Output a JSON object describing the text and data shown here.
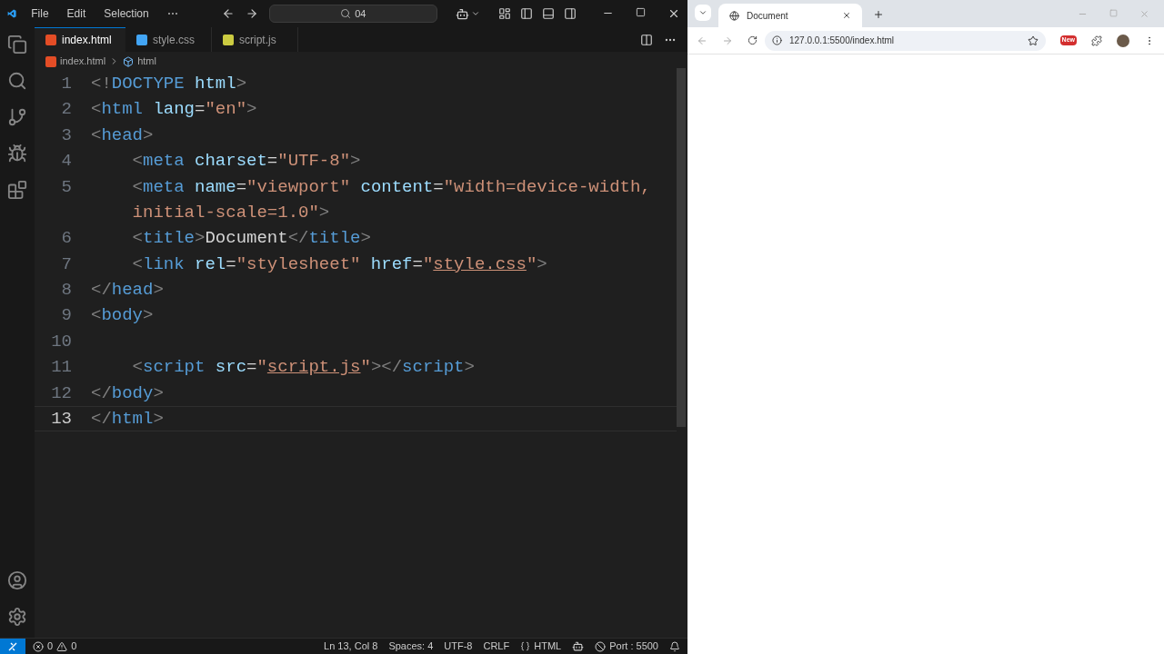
{
  "editor": {
    "menu": [
      "File",
      "Edit",
      "Selection",
      "⋯"
    ],
    "search": "04",
    "tabs": [
      {
        "label": "index.html",
        "kind": "html",
        "selected": true
      },
      {
        "label": "style.css",
        "kind": "css",
        "selected": false
      },
      {
        "label": "script.js",
        "kind": "js",
        "selected": false
      }
    ],
    "breadcrumb": [
      {
        "label": "index.html",
        "kind": "html"
      },
      {
        "label": "html",
        "kind": "element"
      }
    ],
    "lines": [
      {
        "number": "1",
        "current": false,
        "tokens": [
          {
            "kind": "punct",
            "text": "<!"
          },
          {
            "kind": "tag",
            "text": "DOCTYPE"
          },
          {
            "kind": "attr",
            "text": " html"
          },
          {
            "kind": "punct",
            "text": ">"
          }
        ]
      },
      {
        "number": "2",
        "current": false,
        "tokens": [
          {
            "kind": "punct",
            "text": "<"
          },
          {
            "kind": "tag",
            "text": "html"
          },
          {
            "kind": "attr",
            "text": " lang"
          },
          {
            "kind": "plain",
            "text": "="
          },
          {
            "kind": "string",
            "text": "\"en\""
          },
          {
            "kind": "punct",
            "text": ">"
          }
        ]
      },
      {
        "number": "3",
        "current": false,
        "tokens": [
          {
            "kind": "punct",
            "text": "<"
          },
          {
            "kind": "tag",
            "text": "head"
          },
          {
            "kind": "punct",
            "text": ">"
          }
        ]
      },
      {
        "number": "4",
        "current": false,
        "tokens": [
          {
            "kind": "punct",
            "text": "    <"
          },
          {
            "kind": "tag",
            "text": "meta"
          },
          {
            "kind": "attr",
            "text": " charset"
          },
          {
            "kind": "plain",
            "text": "="
          },
          {
            "kind": "string",
            "text": "\"UTF-8\""
          },
          {
            "kind": "punct",
            "text": ">"
          }
        ]
      },
      {
        "number": "5",
        "current": false,
        "tokens": [
          {
            "kind": "punct",
            "text": "    <"
          },
          {
            "kind": "tag",
            "text": "meta"
          },
          {
            "kind": "attr",
            "text": " name"
          },
          {
            "kind": "plain",
            "text": "="
          },
          {
            "kind": "string",
            "text": "\"viewport\""
          },
          {
            "kind": "attr",
            "text": " content"
          },
          {
            "kind": "plain",
            "text": "="
          },
          {
            "kind": "string",
            "text": "\"width=device-width,"
          }
        ]
      },
      {
        "current": false,
        "tokens": [
          {
            "kind": "string",
            "text": "    initial-scale=1.0\""
          },
          {
            "kind": "punct",
            "text": ">"
          }
        ]
      },
      {
        "number": "6",
        "current": false,
        "tokens": [
          {
            "kind": "punct",
            "text": "    <"
          },
          {
            "kind": "tag",
            "text": "title"
          },
          {
            "kind": "punct",
            "text": ">"
          },
          {
            "kind": "plain",
            "text": "Document"
          },
          {
            "kind": "punct",
            "text": "</"
          },
          {
            "kind": "tag",
            "text": "title"
          },
          {
            "kind": "punct",
            "text": ">"
          }
        ]
      },
      {
        "number": "7",
        "current": false,
        "tokens": [
          {
            "kind": "punct",
            "text": "    <"
          },
          {
            "kind": "tag",
            "text": "link"
          },
          {
            "kind": "attr",
            "text": " rel"
          },
          {
            "kind": "plain",
            "text": "="
          },
          {
            "kind": "string",
            "text": "\"stylesheet\""
          },
          {
            "kind": "attr",
            "text": " href"
          },
          {
            "kind": "plain",
            "text": "="
          },
          {
            "kind": "string",
            "text": "\""
          },
          {
            "kind": "link",
            "text": "style.css"
          },
          {
            "kind": "string",
            "text": "\""
          },
          {
            "kind": "punct",
            "text": ">"
          }
        ]
      },
      {
        "number": "8",
        "current": false,
        "tokens": [
          {
            "kind": "punct",
            "text": "</"
          },
          {
            "kind": "tag",
            "text": "head"
          },
          {
            "kind": "punct",
            "text": ">"
          }
        ]
      },
      {
        "number": "9",
        "current": false,
        "tokens": [
          {
            "kind": "punct",
            "text": "<"
          },
          {
            "kind": "tag",
            "text": "body"
          },
          {
            "kind": "punct",
            "text": ">"
          }
        ]
      },
      {
        "number": "10",
        "current": false
      },
      {
        "number": "11",
        "current": false,
        "tokens": [
          {
            "kind": "punct",
            "text": "    <"
          },
          {
            "kind": "tag",
            "text": "script"
          },
          {
            "kind": "attr",
            "text": " src"
          },
          {
            "kind": "plain",
            "text": "="
          },
          {
            "kind": "string",
            "text": "\""
          },
          {
            "kind": "link",
            "text": "script.js"
          },
          {
            "kind": "string",
            "text": "\""
          },
          {
            "kind": "punct",
            "text": "></"
          },
          {
            "kind": "tag",
            "text": "script"
          },
          {
            "kind": "punct",
            "text": ">"
          }
        ]
      },
      {
        "number": "12",
        "current": false,
        "tokens": [
          {
            "kind": "punct",
            "text": "</"
          },
          {
            "kind": "tag",
            "text": "body"
          },
          {
            "kind": "punct",
            "text": ">"
          }
        ]
      },
      {
        "number": "13",
        "current": true,
        "tokens": [
          {
            "kind": "punct",
            "text": "</"
          },
          {
            "kind": "tag",
            "text": "html"
          },
          {
            "kind": "punct",
            "text": ">"
          }
        ]
      }
    ],
    "status_bar": {
      "errors": "0",
      "warnings": "0",
      "items": [
        "Ln 13, Col 8",
        "Spaces: 4",
        "UTF-8",
        "CRLF",
        "HTML"
      ],
      "port": "Port : 5500"
    }
  },
  "browser": {
    "tab": "Document",
    "url": "127.0.0.1:5500/index.html",
    "badge": "New"
  }
}
